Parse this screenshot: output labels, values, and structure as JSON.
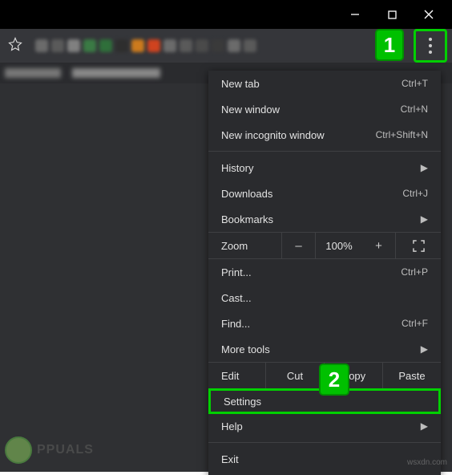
{
  "window_controls": {
    "minimize": "–",
    "maximize": "▢",
    "close": "✕"
  },
  "annotations": {
    "step1": "1",
    "step2": "2"
  },
  "swatch_colors": [
    "#6b6b6b",
    "#5a5a5a",
    "#808080",
    "#3a7a44",
    "#2f6f3a",
    "#2e2e2e",
    "#cc7a1d",
    "#d0431f",
    "#6b6b6b",
    "#5a5a5a",
    "#4a4a4a",
    "#3a3a3a",
    "#6b6b6b",
    "#5a5a5a"
  ],
  "menu": {
    "new_tab": {
      "label": "New tab",
      "shortcut": "Ctrl+T"
    },
    "new_window": {
      "label": "New window",
      "shortcut": "Ctrl+N"
    },
    "new_incognito": {
      "label": "New incognito window",
      "shortcut": "Ctrl+Shift+N"
    },
    "history": {
      "label": "History"
    },
    "downloads": {
      "label": "Downloads",
      "shortcut": "Ctrl+J"
    },
    "bookmarks": {
      "label": "Bookmarks"
    },
    "zoom": {
      "label": "Zoom",
      "minus": "–",
      "value": "100%",
      "plus": "+"
    },
    "print": {
      "label": "Print...",
      "shortcut": "Ctrl+P"
    },
    "cast": {
      "label": "Cast..."
    },
    "find": {
      "label": "Find...",
      "shortcut": "Ctrl+F"
    },
    "more_tools": {
      "label": "More tools"
    },
    "edit": {
      "label": "Edit",
      "cut": "Cut",
      "copy": "Copy",
      "paste": "Paste"
    },
    "settings": {
      "label": "Settings"
    },
    "help": {
      "label": "Help"
    },
    "exit": {
      "label": "Exit"
    }
  },
  "watermark": {
    "text": "PPUALS"
  },
  "footer": {
    "src": "wsxdn.com"
  }
}
